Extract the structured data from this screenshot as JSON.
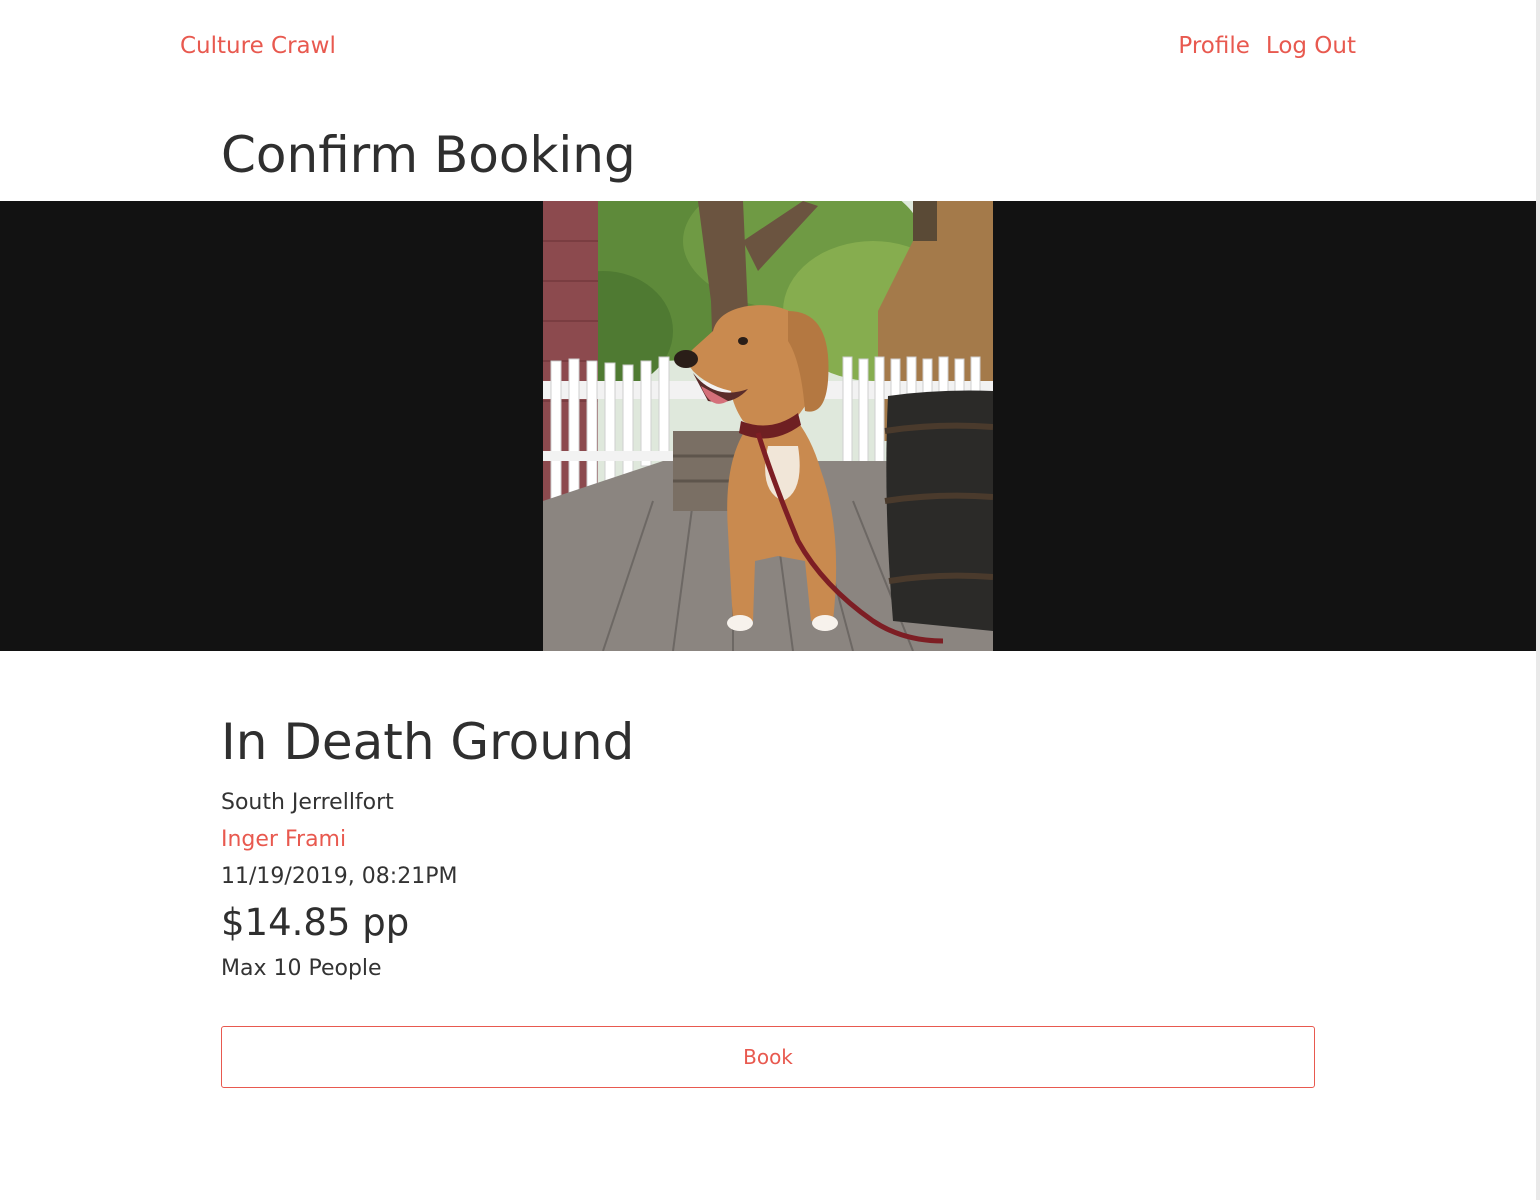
{
  "nav": {
    "brand": "Culture Crawl",
    "links": [
      "Profile",
      "Log Out"
    ]
  },
  "page": {
    "title": "Confirm Booking"
  },
  "event": {
    "image_icon": "dog-photo",
    "title": "In Death Ground",
    "location": "South Jerrellfort",
    "host": "Inger Frami",
    "datetime": "11/19/2019, 08:21PM",
    "price": "$14.85 pp",
    "capacity": "Max 10 People"
  },
  "actions": {
    "book_label": "Book"
  },
  "colors": {
    "accent": "#e8594f",
    "text": "#333333",
    "hero_background": "#121212"
  }
}
